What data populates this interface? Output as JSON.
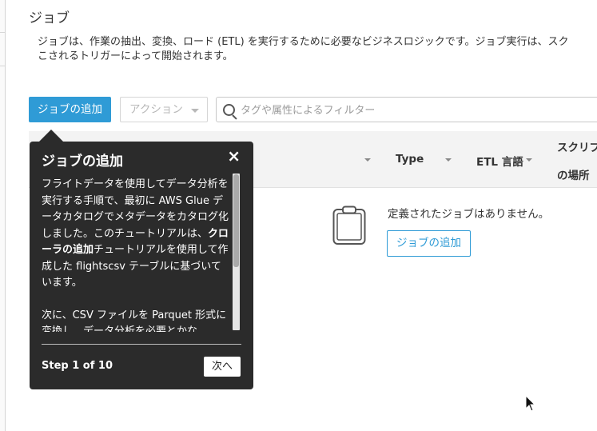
{
  "page": {
    "title": "ジョブ",
    "description_line1": "ジョブは、作業の抽出、変換、ロード (ETL) を実行するために必要なビジネスロジックです。ジョブ実行は、スク",
    "description_line2": "こされるトリガーによって開始されます。"
  },
  "toolbar": {
    "add_job_label": "ジョブの追加",
    "action_label": "アクション",
    "filter_placeholder": "タグや属性によるフィルター"
  },
  "table": {
    "columns": [
      "Type",
      "ETL 言語",
      "スクリプ",
      "の場所"
    ],
    "empty_message": "定義されたジョブはありません。",
    "add_job_label": "ジョブの追加"
  },
  "popover": {
    "title": "ジョブの追加",
    "close_symbol": "×",
    "body_pre": "フライトデータを使用してデータ分析を実行する手順で、最初に AWS Glue データカタログでメタデータをカタログ化しました。このチュートリアルは、",
    "body_bold": "クローラの追加",
    "body_post": "チュートリアルを使用して作成した flightscsv テーブルに基づいています。",
    "body_para2": "次に、CSV ファイルを Parquet 形式に変換し、データ分析を必要とかな",
    "step_text": "Step 1 of 10",
    "next_label": "次へ"
  },
  "colors": {
    "primary": "#2f9bd6",
    "popover_bg": "#2b2b2b",
    "header_bg": "#f3f3f3"
  }
}
